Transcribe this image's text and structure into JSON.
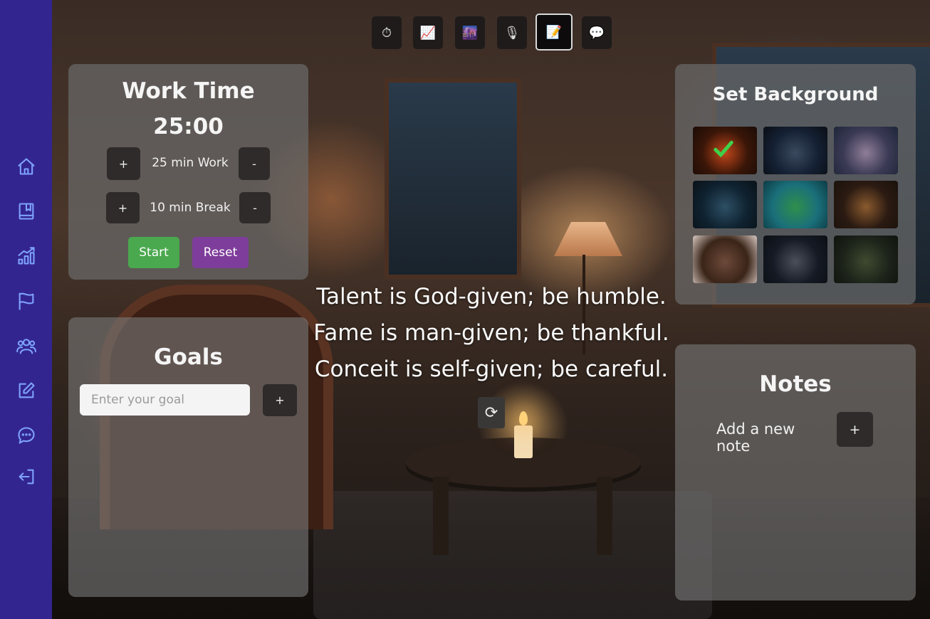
{
  "sidebar": {
    "items": [
      {
        "name": "home",
        "icon": "home-icon"
      },
      {
        "name": "book",
        "icon": "book-icon"
      },
      {
        "name": "stats",
        "icon": "bar-chart-icon"
      },
      {
        "name": "goals",
        "icon": "flag-icon"
      },
      {
        "name": "community",
        "icon": "users-icon"
      },
      {
        "name": "notes",
        "icon": "edit-icon"
      },
      {
        "name": "chat",
        "icon": "chat-icon"
      },
      {
        "name": "logout",
        "icon": "logout-icon"
      }
    ],
    "color": "#33258f",
    "icon_color": "#7ea2ff"
  },
  "toolbar": {
    "buttons": [
      {
        "glyph": "⏱",
        "icon": "stopwatch-icon"
      },
      {
        "glyph": "📈",
        "icon": "chart-icon"
      },
      {
        "glyph": "🌆",
        "icon": "scenery-icon"
      },
      {
        "glyph": "🎙",
        "icon": "microphone-icon"
      },
      {
        "glyph": "📝",
        "icon": "memo-icon",
        "active": true
      },
      {
        "glyph": "💬",
        "icon": "speech-bubble-icon"
      }
    ]
  },
  "timer": {
    "title": "Work Time",
    "time": "25:00",
    "work": {
      "plus": "+",
      "label": "25 min Work",
      "minus": "-"
    },
    "break": {
      "plus": "+",
      "label": "10 min Break",
      "minus": "-"
    },
    "start_label": "Start",
    "reset_label": "Reset",
    "start_color": "#4aa84e",
    "reset_color": "#7e3d9a"
  },
  "goals": {
    "title": "Goals",
    "placeholder": "Enter your goal",
    "value": "",
    "add_label": "+"
  },
  "quote": {
    "lines": [
      "Talent is God-given; be humble.",
      "Fame is man-given; be thankful.",
      "Conceit is self-given; be careful."
    ],
    "refresh_glyph": "⟳"
  },
  "background": {
    "title": "Set Background",
    "thumbnails": [
      {
        "name": "fireplace",
        "selected": true,
        "colors": [
          "#3a1608",
          "#c2461a",
          "#1b0c06"
        ]
      },
      {
        "name": "night-sky",
        "selected": false,
        "colors": [
          "#142033",
          "#3b4a5e",
          "#0b0f16"
        ]
      },
      {
        "name": "lake-sunset",
        "selected": false,
        "colors": [
          "#3b3a55",
          "#8f7e98",
          "#1e2638"
        ]
      },
      {
        "name": "city-night",
        "selected": false,
        "colors": [
          "#0f2230",
          "#2d4f64",
          "#0a1218"
        ]
      },
      {
        "name": "tree-underwater",
        "selected": false,
        "colors": [
          "#1a6f7a",
          "#2f8f4b",
          "#0d3b44"
        ]
      },
      {
        "name": "restaurant",
        "selected": false,
        "colors": [
          "#2a1a12",
          "#8a5a2e",
          "#1a120c"
        ]
      },
      {
        "name": "snowy-street",
        "selected": false,
        "colors": [
          "#3a2418",
          "#6d4a3a",
          "#d8c9c2"
        ]
      },
      {
        "name": "city-lights",
        "selected": false,
        "colors": [
          "#151a24",
          "#4a4f5a",
          "#0c0f14"
        ]
      },
      {
        "name": "forest-ruins",
        "selected": false,
        "colors": [
          "#1d241a",
          "#3f4a30",
          "#0f130d"
        ]
      }
    ]
  },
  "notes": {
    "title": "Notes",
    "add_text": "Add a new note",
    "add_label": "+"
  }
}
